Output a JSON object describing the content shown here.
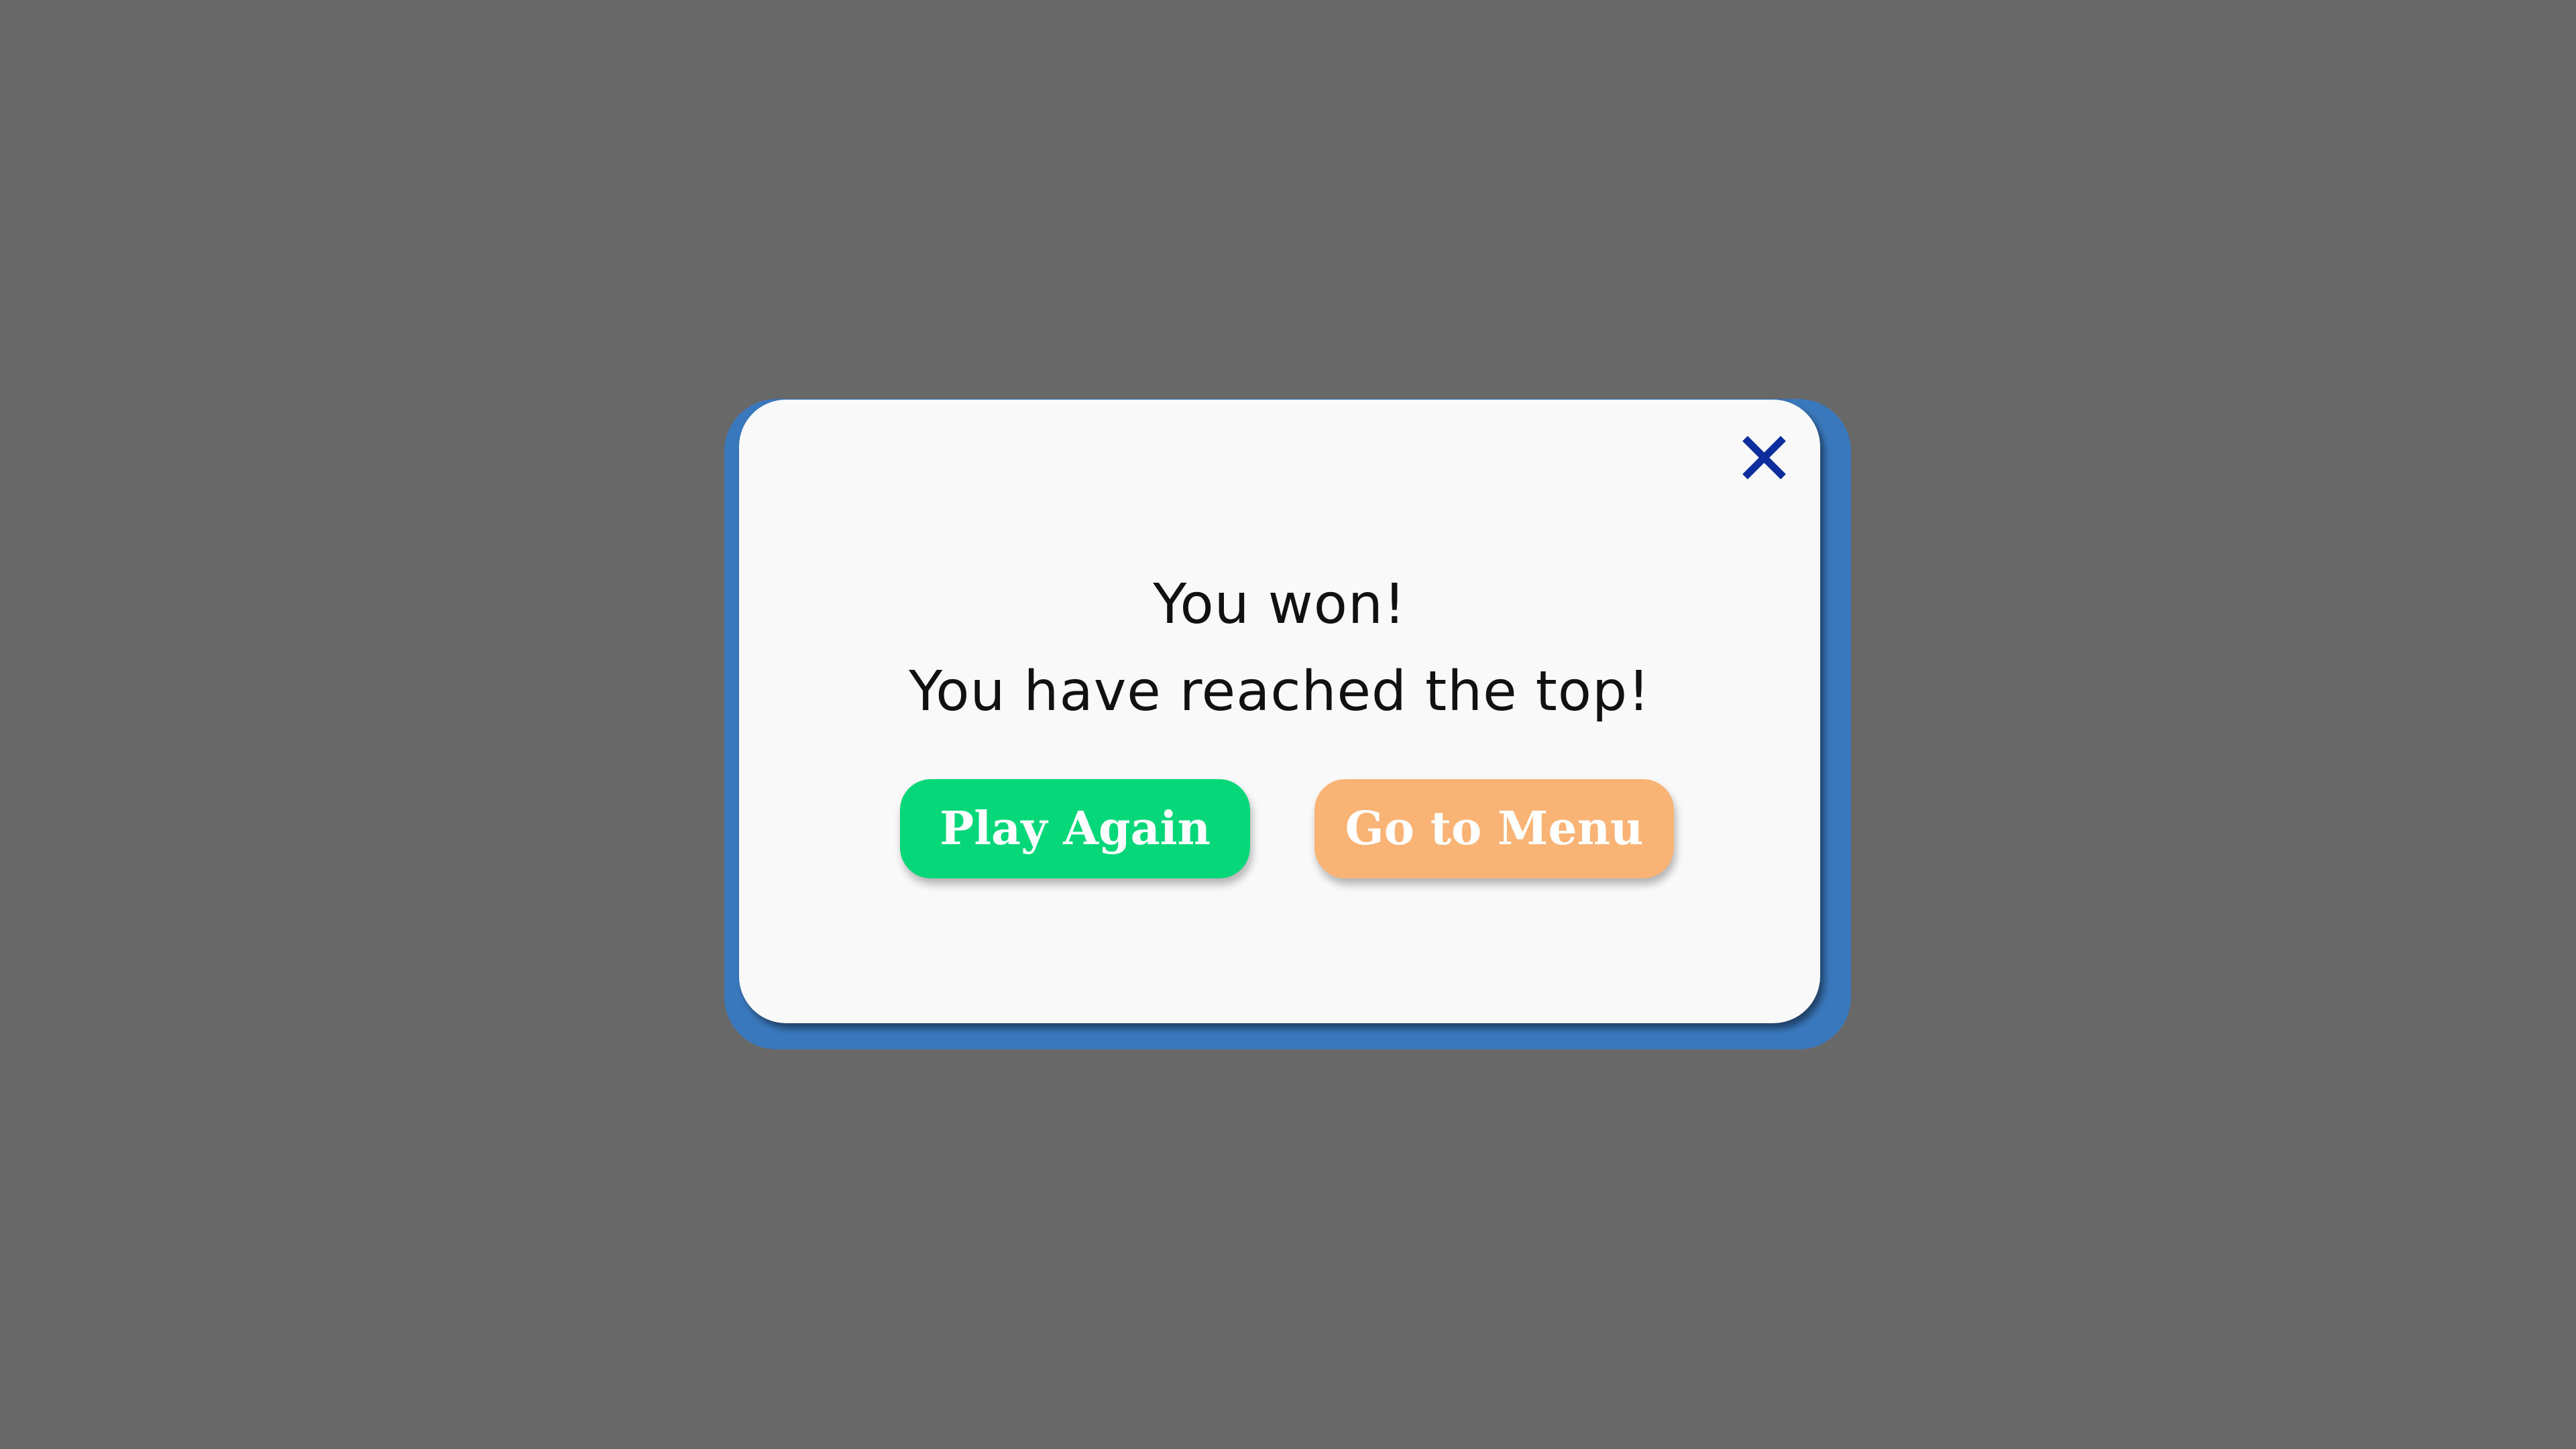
{
  "dialog": {
    "title_line_1": "You won!",
    "title_line_2": "You have reached the top!",
    "close_icon": "close-x-icon",
    "buttons": {
      "play_again_label": "Play Again",
      "go_to_menu_label": "Go to Menu"
    }
  },
  "colors": {
    "backdrop": "#686868",
    "frame": "#3a78bd",
    "card": "#f9f9f9",
    "close_icon": "#0d2e9c",
    "play_again": "#06d87a",
    "go_to_menu": "#f9b475",
    "title_text": "#111111",
    "button_text": "#ffffff"
  }
}
